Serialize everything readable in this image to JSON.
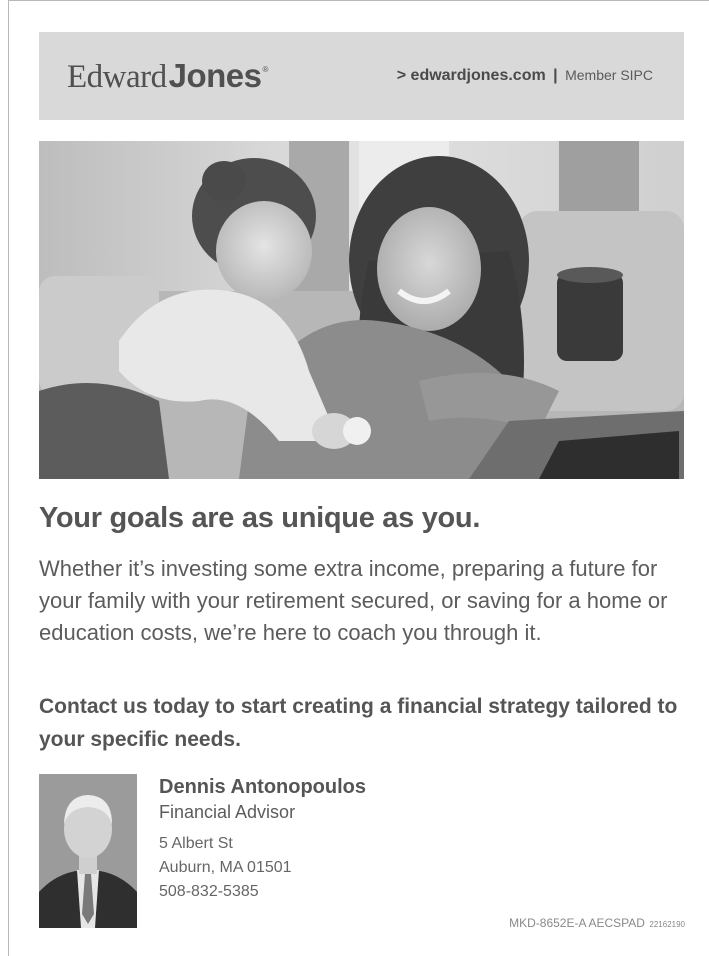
{
  "header": {
    "logo_part1": "Edward",
    "logo_part2": "Jones",
    "logo_reg": "®",
    "site": "> edwardjones.com",
    "separator": "|",
    "member": "Member SIPC"
  },
  "headline": "Your goals are as unique as you.",
  "body": "Whether it’s investing some extra income, preparing a future for your family with your retirement secured, or saving for a home or education costs, we’re here to coach you through it.",
  "cta": "Contact us today to start creating a financial strategy tailored to your specific needs.",
  "advisor": {
    "name": "Dennis Antonopoulos",
    "title": "Financial Advisor",
    "address1": "5 Albert St",
    "address2": "Auburn, MA 01501",
    "phone": "508-832-5385"
  },
  "code": {
    "main": "MKD-8652E-A AECSPAD",
    "small": "22162190"
  }
}
